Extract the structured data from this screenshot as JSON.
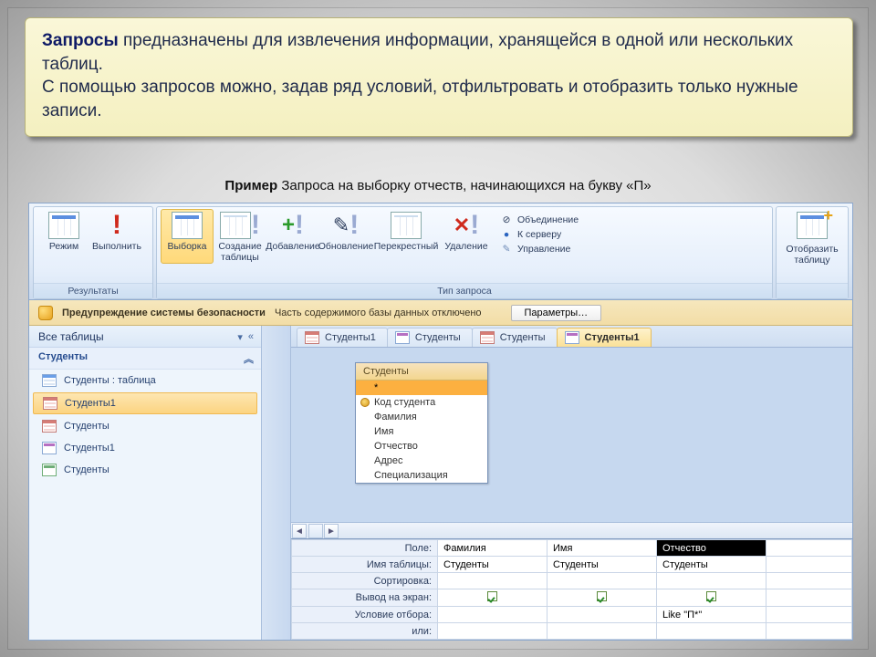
{
  "info": {
    "bold": "Запросы",
    "line1_rest": " предназначены для извлечения информации, хранящейся в одной или нескольких таблиц.",
    "line2": "С помощью запросов можно, задав ряд условий, отфильтровать и отобразить только нужные записи."
  },
  "caption": {
    "bold": "Пример ",
    "rest": "Запроса на выборку отчеств, начинающихся на букву «П»"
  },
  "ribbon": {
    "groups": {
      "results": {
        "title": "Результаты",
        "mode": "Режим",
        "run": "Выполнить"
      },
      "type": {
        "title": "Тип запроса",
        "select": "Выборка",
        "maketable_l1": "Создание",
        "maketable_l2": "таблицы",
        "append": "Добавление",
        "update": "Обновление",
        "xtab": "Перекрестный",
        "delete": "Удаление"
      },
      "extra": {
        "union": "Объединение",
        "passthrough": "К серверу",
        "datadef": "Управление"
      },
      "show": {
        "show_l1": "Отобразить",
        "show_l2": "таблицу"
      }
    }
  },
  "security": {
    "title": "Предупреждение системы безопасности",
    "msg": "Часть содержимого базы данных отключено",
    "btn": "Параметры…"
  },
  "nav": {
    "head": "Все таблицы",
    "group": "Студенты",
    "items": [
      {
        "label": "Студенты : таблица",
        "kind": "tbl"
      },
      {
        "label": "Студенты1",
        "kind": "qry",
        "sel": true
      },
      {
        "label": "Студенты",
        "kind": "qry"
      },
      {
        "label": "Студенты1",
        "kind": "frm"
      },
      {
        "label": "Студенты",
        "kind": "rpt"
      }
    ]
  },
  "tabs": [
    "Студенты1",
    "Студенты",
    "Студенты",
    "Студенты1"
  ],
  "active_tab": 3,
  "tablebox": {
    "title": "Студенты",
    "fields": [
      "*",
      "Код студента",
      "Фамилия",
      "Имя",
      "Отчество",
      "Адрес",
      "Специализация"
    ]
  },
  "qbe": {
    "labels": [
      "Поле:",
      "Имя таблицы:",
      "Сортировка:",
      "Вывод на экран:",
      "Условие отбора:",
      "или:"
    ],
    "cols": [
      {
        "field": "Фамилия",
        "table": "Студенты",
        "show": true,
        "crit": ""
      },
      {
        "field": "Имя",
        "table": "Студенты",
        "show": true,
        "crit": ""
      },
      {
        "field": "Отчество",
        "table": "Студенты",
        "show": true,
        "crit": "Like \"П*\"",
        "selected": true
      }
    ]
  }
}
